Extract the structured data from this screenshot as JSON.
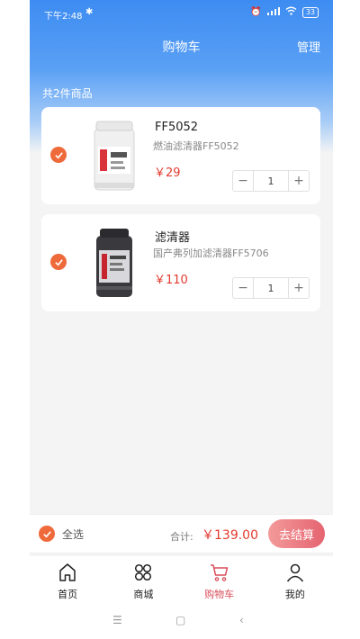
{
  "status_bar": {
    "time": "下午2:48",
    "battery": "33"
  },
  "header": {
    "title": "购物车",
    "manage": "管理"
  },
  "cart": {
    "count_label": "共2件商品",
    "items": [
      {
        "name": "FF5052",
        "desc": "燃油滤清器FF5052",
        "price": "￥29",
        "qty": "1",
        "checked": true
      },
      {
        "name": "滤清器",
        "desc": "国产弗列加滤清器FF5706",
        "price": "￥110",
        "qty": "1",
        "checked": true
      }
    ]
  },
  "checkout": {
    "select_all": "全选",
    "total_label": "合计:",
    "total_value": "￥139.00",
    "button": "去结算"
  },
  "tabbar": {
    "items": [
      {
        "label": "首页",
        "icon": "home-icon"
      },
      {
        "label": "商城",
        "icon": "grid-flower-icon"
      },
      {
        "label": "购物车",
        "icon": "cart-icon",
        "active": true
      },
      {
        "label": "我的",
        "icon": "user-icon"
      }
    ]
  },
  "colors": {
    "accent": "#ef6a3b",
    "price": "#e23a2e",
    "header_blue": "#3d8cf2",
    "active_tab": "#d94c59"
  }
}
